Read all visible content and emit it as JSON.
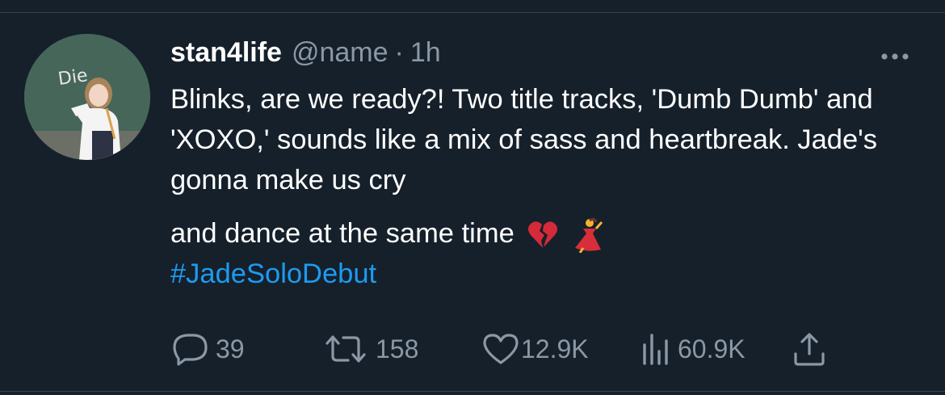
{
  "tweet": {
    "author": {
      "display_name": "stan4life",
      "handle": "@name",
      "avatar_caption": "Die"
    },
    "separator": "·",
    "time": "1h",
    "text": {
      "paragraph": "Blinks, are we ready?! Two title tracks, 'Dumb Dumb' and 'XOXO,' sounds like a mix of sass and heartbreak. Jade's gonna make us cry",
      "second_line": "and dance at the same time",
      "hashtag": "#JadeSoloDebut"
    },
    "emojis": [
      "broken-heart-emoji",
      "dancer-emoji"
    ],
    "actions": {
      "replies": "39",
      "retweets": "158",
      "likes": "12.9K",
      "views": "60.9K"
    },
    "icons": {
      "more": "more-horizontal-icon",
      "reply": "reply-icon",
      "retweet": "retweet-icon",
      "like": "heart-icon",
      "views": "views-icon",
      "share": "share-icon"
    },
    "colors": {
      "background": "#15202b",
      "text": "#ffffff",
      "muted": "#8b98a5",
      "link": "#1d9bf0",
      "divider": "#38444d"
    }
  }
}
